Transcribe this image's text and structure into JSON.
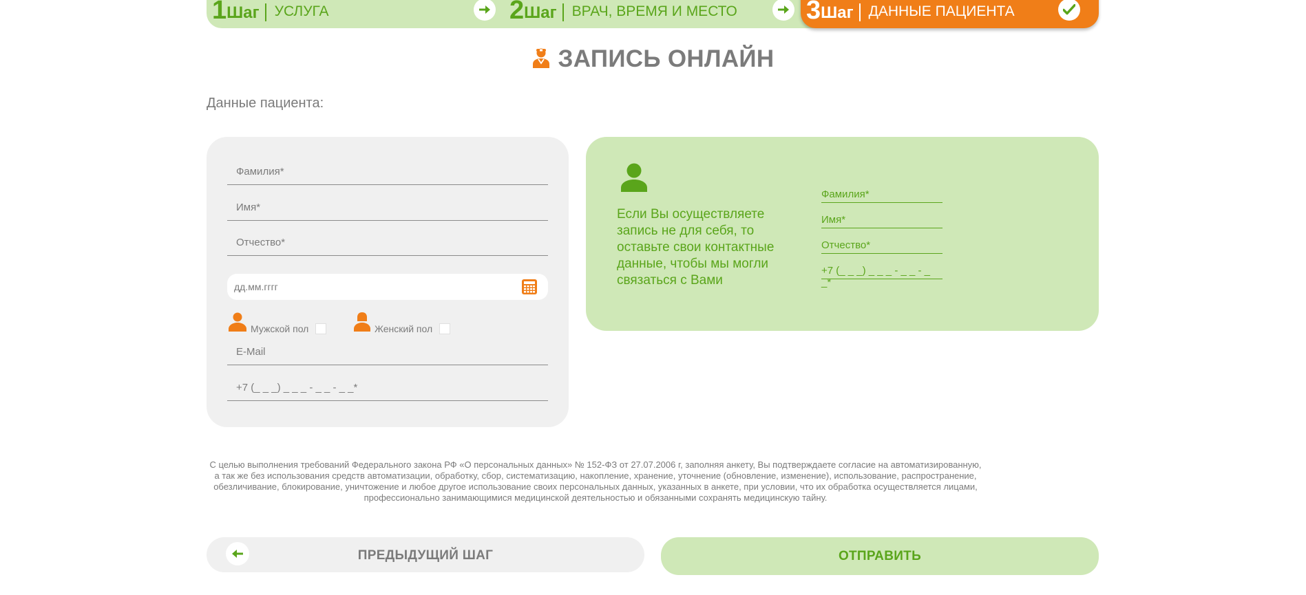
{
  "steps": [
    {
      "num": "1",
      "word": "Шаг",
      "label": "УСЛУГА"
    },
    {
      "num": "2",
      "word": "Шаг",
      "label": "ВРАЧ, ВРЕМЯ И МЕСТО"
    },
    {
      "num": "3",
      "word": "Шаг",
      "label": "ДАННЫЕ ПАЦИЕНТА"
    }
  ],
  "page_title": "ЗАПИСЬ ОНЛАЙН",
  "section_label": "Данные пациента:",
  "patient_form": {
    "last_name": "Фамилия*",
    "first_name": "Имя*",
    "middle_name": "Отчество*",
    "birth_date_placeholder": "дд.мм.гггг",
    "male_label": "Мужской пол",
    "female_label": "Женский пол",
    "email": "E-Mail",
    "phone": "+7 (_ _ _) _ _ _ - _ _ - _ _*"
  },
  "contact_form": {
    "note": "Если Вы осуществляете запись не для себя, то оставьте свои контактные данные, чтобы мы могли связаться с Вами",
    "last_name": "Фамилия*",
    "first_name": "Имя*",
    "middle_name": "Отчество*",
    "phone": "+7 (_ _ _) _ _ _ - _ _ - _ _*"
  },
  "legal_text": "С целью выполнения требований Федерального закона РФ «О персональных данных» № 152-ФЗ от 27.07.2006 г, заполняя анкету, Вы подтверждаете согласие на автоматизированную, а так же без использования средств автоматизации, обработку, сбор, систематизацию, накопление, хранение, уточнение (обновление, изменение), использование, распространение, обезличивание, блокирование, уничтожение и любое другое использование своих персональных данных, указанных в анкете, при условии, что их обработка осуществляется лицами, профессионально занимающимися медицинской деятельностью и обязанными сохранять медицинскую тайну.",
  "buttons": {
    "prev": "ПРЕДЫДУЩИЙ ШАГ",
    "send": "ОТПРАВИТЬ"
  },
  "colors": {
    "green": "#5aa51b",
    "green_light": "#cfe8b7",
    "orange": "#f07e18",
    "gray_bg": "#f0f0f0",
    "gray_text": "#7b7b7b"
  },
  "icons": {
    "step_arrow": "arrow-right-icon",
    "step_done": "checkmark-icon",
    "title": "doctor-icon",
    "calendar": "calendar-icon",
    "male": "male-person-icon",
    "female": "female-person-icon",
    "contact": "person-icon",
    "prev": "arrow-left-icon"
  }
}
